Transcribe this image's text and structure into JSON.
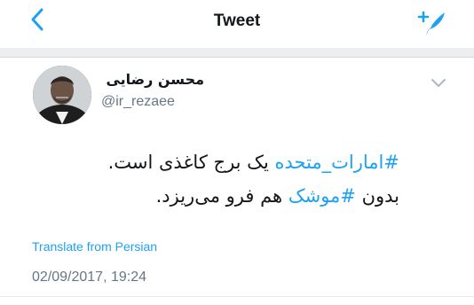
{
  "header": {
    "title": "Tweet",
    "back_icon": "chevron-left-icon",
    "compose_icon": "compose-tweet-icon",
    "accent": "#1da1f2"
  },
  "tweet": {
    "author_name": "محسن رضایی",
    "handle": "@ir_rezaee",
    "avatar_icon": "user-avatar",
    "menu_icon": "chevron-down-icon",
    "line1_hashtag": "#امارات_متحده",
    "line1_text": " یک برج کاغذی است.",
    "line2_pre": "بدون ",
    "line2_hashtag": "#موشک",
    "line2_text": " هم فرو می‌ریزد.",
    "translate_label": "Translate from Persian",
    "timestamp": "02/09/2017, 19:24"
  }
}
